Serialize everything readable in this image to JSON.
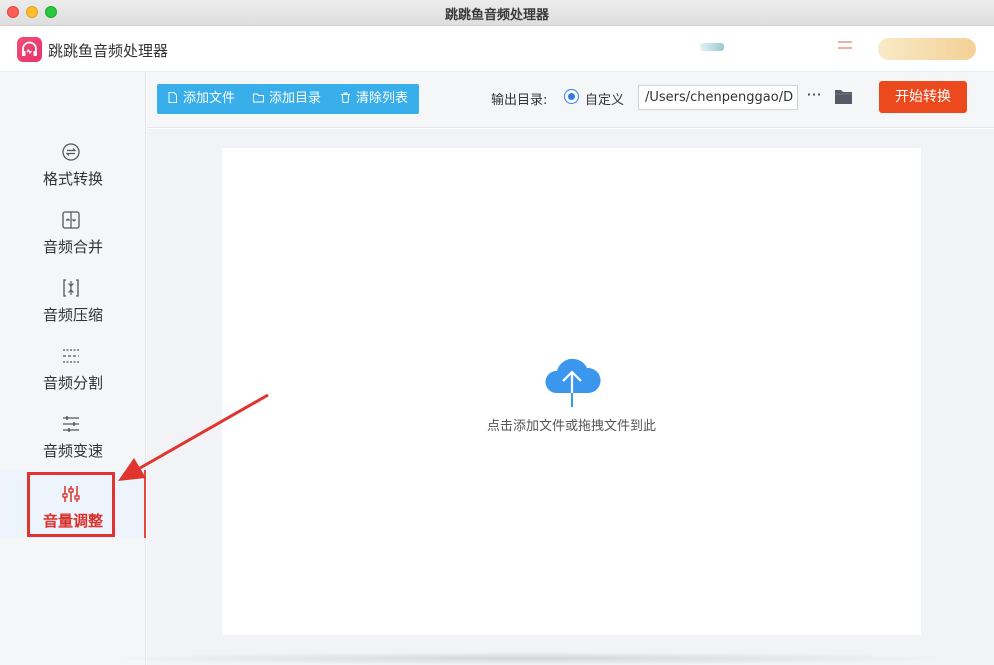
{
  "window": {
    "title": "跳跳鱼音频处理器"
  },
  "app": {
    "name": "跳跳鱼音频处理器"
  },
  "sidebar": {
    "items": [
      {
        "label": "格式转换",
        "icon": "format-convert-icon"
      },
      {
        "label": "音频合并",
        "icon": "merge-icon"
      },
      {
        "label": "音频压缩",
        "icon": "compress-icon"
      },
      {
        "label": "音频分割",
        "icon": "split-icon"
      },
      {
        "label": "音频变速",
        "icon": "speed-icon"
      },
      {
        "label": "音量调整",
        "icon": "volume-sliders-icon",
        "active": true
      }
    ]
  },
  "toolbar": {
    "add_file": "添加文件",
    "add_folder": "添加目录",
    "clear_list": "清除列表",
    "output_label": "输出目录:",
    "custom_label": "自定义",
    "output_path": "/Users/chenpenggao/D",
    "more": "···",
    "start": "开始转换"
  },
  "dropzone": {
    "hint": "点击添加文件或拖拽文件到此",
    "icon": "cloud-upload-icon"
  },
  "colors": {
    "accent_blue": "#38aeea",
    "start_button": "#ec4a1e",
    "active_red": "#d9312b",
    "annotation_red": "#e0352e"
  }
}
